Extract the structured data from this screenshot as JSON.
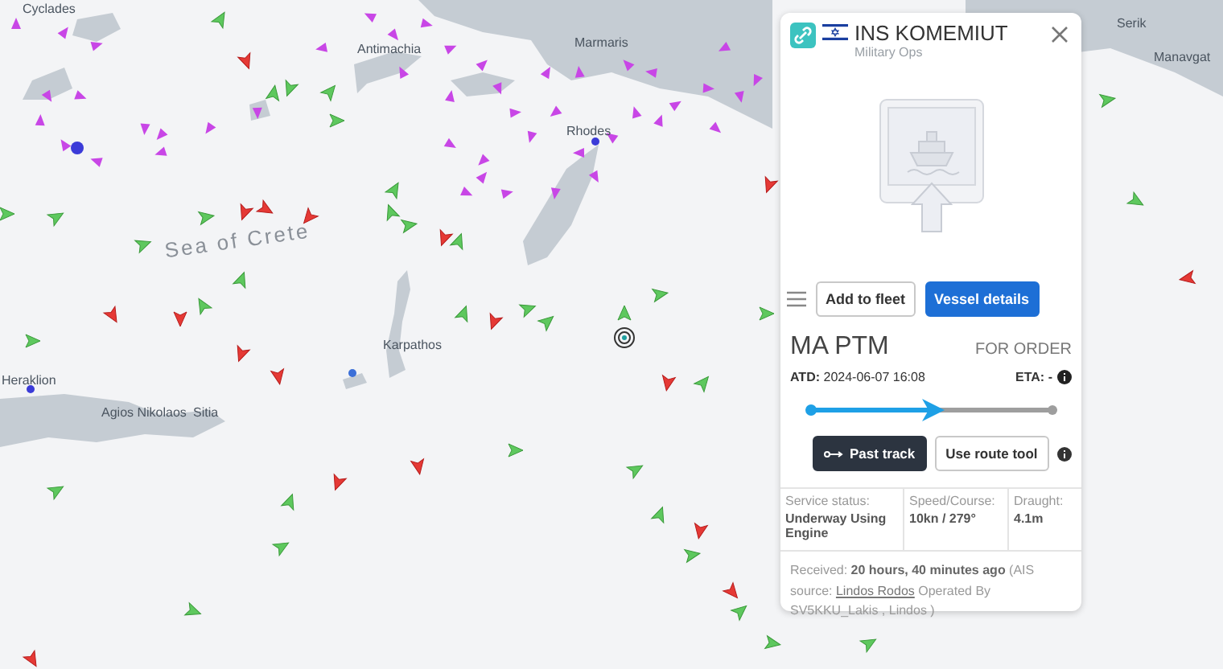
{
  "map": {
    "labels": [
      {
        "text": "Cyclades"
      },
      {
        "text": "Antimachia"
      },
      {
        "text": "Marmaris"
      },
      {
        "text": "Rhodes"
      },
      {
        "text": "Sea of Crete"
      },
      {
        "text": "Karpathos"
      },
      {
        "text": "Heraklion"
      },
      {
        "text": "Agios Nikolaos"
      },
      {
        "text": "Sitia"
      },
      {
        "text": "Serik"
      },
      {
        "text": "Manavgat"
      }
    ]
  },
  "vessel": {
    "name": "INS KOMEMIUT",
    "type": "Military Ops",
    "actions": [
      "Add to fleet",
      "Vessel details"
    ],
    "origin": "MA PTM",
    "destination": "FOR ORDER",
    "atd_label": "ATD:",
    "atd": "2024-06-07 16:08",
    "eta_label": "ETA:",
    "eta": "-",
    "progress": {
      "level": 0.52
    },
    "track_buttons": [
      {
        "label": "Past track",
        "selected": true
      },
      {
        "label": "Use route tool",
        "selected": false
      }
    ],
    "stats": [
      {
        "label": "Service status:",
        "value": "Underway Using Engine"
      },
      {
        "label": "Speed/Course:",
        "value": "10kn / 279°"
      },
      {
        "label": "Draught:",
        "value": "4.1m"
      }
    ],
    "received": {
      "text": "Received: **20 hours, 40 minutes ago** (AIS source:",
      "link": "Lindos Rodos",
      "rest": "Operated By SV5KKU_Lakis , Lindos )"
    }
  }
}
